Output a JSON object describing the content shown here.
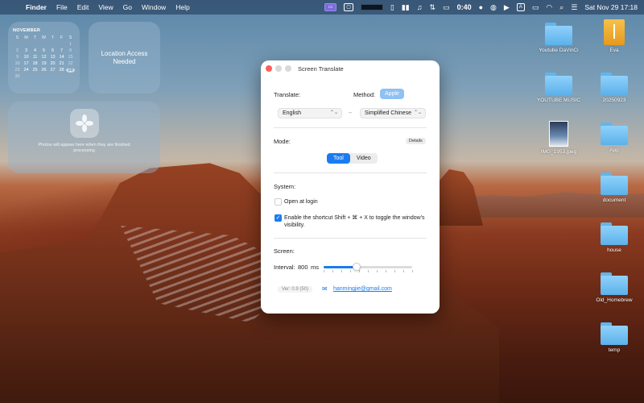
{
  "menubar": {
    "app_name": "Finder",
    "menus": [
      "File",
      "Edit",
      "View",
      "Go",
      "Window",
      "Help"
    ],
    "timer": "0:40",
    "datetime": "Sat Nov 29  17:18",
    "input_source": "A"
  },
  "widgets": {
    "calendar": {
      "month": "NOVEMBER",
      "weekdays": [
        "S",
        "M",
        "T",
        "W",
        "T",
        "F",
        "S"
      ],
      "rows": [
        [
          "",
          "",
          "",
          "",
          "",
          "",
          "1"
        ],
        [
          "2",
          "3",
          "4",
          "5",
          "6",
          "7",
          "8"
        ],
        [
          "9",
          "10",
          "11",
          "12",
          "13",
          "14",
          "15"
        ],
        [
          "16",
          "17",
          "18",
          "19",
          "20",
          "21",
          "22"
        ],
        [
          "23",
          "24",
          "25",
          "26",
          "27",
          "28",
          "29"
        ],
        [
          "30",
          "",
          "",
          "",
          "",
          "",
          ""
        ]
      ],
      "today": "29"
    },
    "location": {
      "text": "Location Access Needed"
    },
    "photos": {
      "text": "Photos will appear here when they are finished processing"
    }
  },
  "desktop": {
    "items": [
      {
        "label": "Youtube DaVinCi",
        "kind": "folder"
      },
      {
        "label": "Eva",
        "kind": "pdf"
      },
      {
        "label": "YOUTUBE MUSIC",
        "kind": "folder"
      },
      {
        "label": "20250923",
        "kind": "folder"
      },
      {
        "label": "IMG_1953.jpeg",
        "kind": "image"
      },
      {
        "label": "App",
        "kind": "folder"
      },
      {
        "label": "document",
        "kind": "folder"
      },
      {
        "label": "house",
        "kind": "folder"
      },
      {
        "label": "Old_Homebrew",
        "kind": "folder"
      },
      {
        "label": "temp",
        "kind": "folder"
      }
    ]
  },
  "window": {
    "title": "Screen Translate",
    "translate_label": "Translate:",
    "method_label": "Method:",
    "method_value": "Apple",
    "source_language": "English",
    "target_language": "Simplified Chinese",
    "arrow": "→",
    "mode_label": "Mode:",
    "details_label": "Details",
    "mode_options": [
      "Tool",
      "Video"
    ],
    "mode_selected": "Tool",
    "system_label": "System:",
    "open_at_login": {
      "label": "Open at login",
      "checked": false
    },
    "shortcut": {
      "label": "Enable the shortcut Shift + ⌘ + X to toggle the window's visibility.",
      "checked": true
    },
    "screen_label": "Screen:",
    "interval_label": "Interval:",
    "interval_value": "800",
    "interval_unit": "ms",
    "interval_fraction": 0.37,
    "version": "Ver: 0.9 (50)",
    "email": "hanmingjie@gmail.com"
  },
  "colors": {
    "accent": "#1a7cf0",
    "close": "#ff5f57",
    "method_button": "#8fc1f2"
  }
}
